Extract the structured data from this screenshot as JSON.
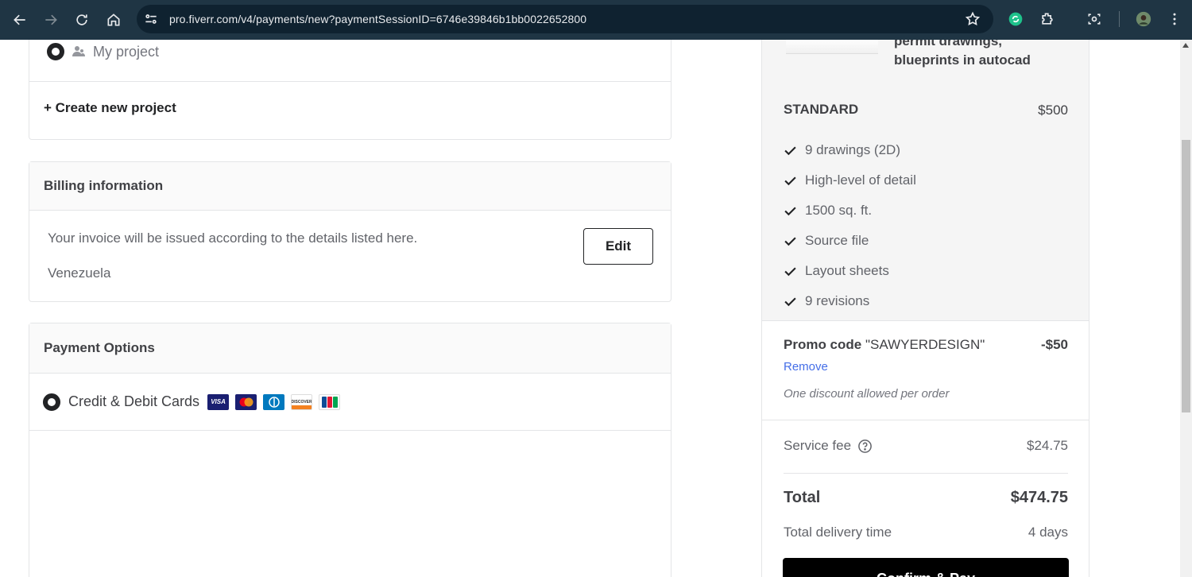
{
  "browser": {
    "url": "pro.fiverr.com/v4/payments/new?paymentSessionID=6746e39846b1bb0022652800"
  },
  "project": {
    "my_project_label": "My project",
    "create_new_label": "+ Create new project"
  },
  "billing": {
    "title": "Billing information",
    "description": "Your invoice will be issued according to the details listed here.",
    "country": "Venezuela",
    "edit_label": "Edit"
  },
  "payment": {
    "title": "Payment Options",
    "method_label": "Credit & Debit Cards",
    "card_icons": [
      "visa-icon",
      "mastercard-icon",
      "diners-club-icon",
      "discover-icon",
      "jcb-icon"
    ]
  },
  "order": {
    "gig_title": "permit drawings, blueprints in autocad",
    "package_name": "STANDARD",
    "package_price": "$500",
    "features": [
      "9 drawings (2D)",
      "High-level of detail",
      "1500 sq. ft.",
      "Source file",
      "Layout sheets",
      "9 revisions"
    ],
    "promo_prefix": "Promo code",
    "promo_code": "\"SAWYERDESIGN\"",
    "promo_amount": "-$50",
    "promo_remove": "Remove",
    "promo_note": "One discount allowed per order",
    "service_fee_label": "Service fee",
    "service_fee_amount": "$24.75",
    "total_label": "Total",
    "total_amount": "$474.75",
    "delivery_label": "Total delivery time",
    "delivery_value": "4 days",
    "confirm_label": "Confirm & Pay"
  },
  "colors": {
    "chrome_bg": "#1f3544",
    "link_blue": "#446ee7",
    "confirm_bg": "#000000"
  }
}
